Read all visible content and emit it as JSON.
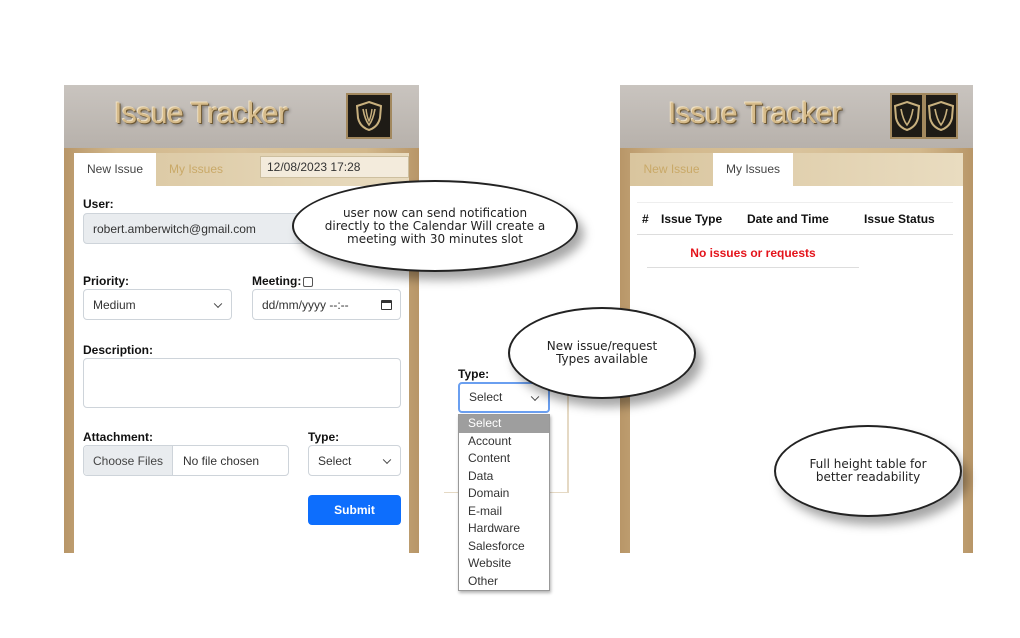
{
  "app_title": "Issue Tracker",
  "left": {
    "tabs": [
      "New Issue",
      "My Issues"
    ],
    "datetime": "12/08/2023 17:28",
    "user_label": "User:",
    "user_value": "robert.amberwitch@gmail.com",
    "priority_label": "Priority:",
    "priority_value": "Medium",
    "meeting_label": "Meeting:",
    "meeting_placeholder": "dd/mm/yyyy --:--",
    "description_label": "Description:",
    "attachment_label": "Attachment:",
    "choose_files": "Choose Files",
    "no_file": "No file chosen",
    "type_label": "Type:",
    "type_value": "Select",
    "submit": "Submit"
  },
  "middle": {
    "type_label": "Type:",
    "type_value": "Select",
    "options": [
      "Select",
      "Account",
      "Content",
      "Data",
      "Domain",
      "E-mail",
      "Hardware",
      "Salesforce",
      "Website",
      "Other"
    ]
  },
  "right": {
    "tabs": [
      "New Issue",
      "My Issues"
    ],
    "columns": [
      "#",
      "Issue Type",
      "Date and Time",
      "Issue Status"
    ],
    "empty_message": "No issues or requests"
  },
  "callouts": {
    "calendar": "user now can send notification directly to the Calendar Will create a meeting with 30 minutes slot",
    "types": "New issue/request Types available",
    "table": "Full height table for better readability"
  }
}
